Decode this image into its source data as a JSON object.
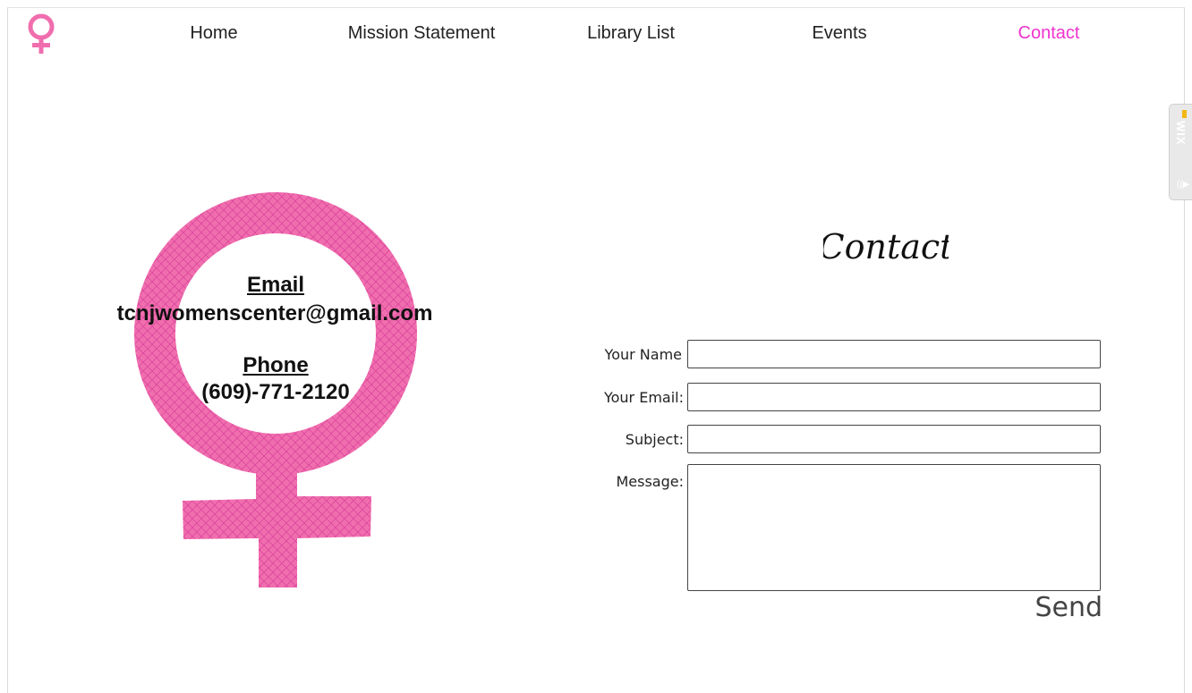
{
  "nav": {
    "items": [
      {
        "label": "Home",
        "active": false
      },
      {
        "label": "Mission Statement",
        "active": false
      },
      {
        "label": "Library List",
        "active": false
      },
      {
        "label": "Events",
        "active": false
      },
      {
        "label": "Contact",
        "active": true
      }
    ]
  },
  "wix_badge": {
    "label": "WIX"
  },
  "info": {
    "email_heading": "Email",
    "email": "tcnjwomenscenter@gmail.com",
    "phone_heading": "Phone",
    "phone": "(609)-771-2120"
  },
  "contact": {
    "title": "Contact",
    "fields": {
      "name_label": "Your Name",
      "email_label": "Your Email:",
      "subject_label": "Subject:",
      "message_label": "Message:"
    },
    "values": {
      "name": "",
      "email": "",
      "subject": "",
      "message": ""
    },
    "send_label": "Send"
  },
  "colors": {
    "accent": "#f032cf",
    "symbol_pink": "#f06eae",
    "text": "#222222"
  }
}
